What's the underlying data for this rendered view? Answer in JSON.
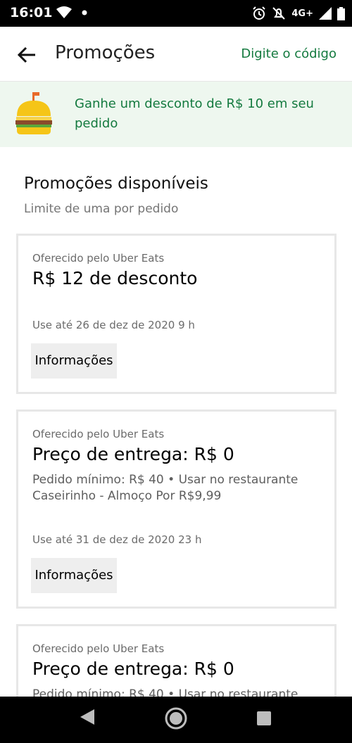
{
  "status_bar": {
    "time": "16:01",
    "network": "4G+",
    "icons": [
      "wifi-icon",
      "dot-icon",
      "alarm-icon",
      "mute-icon",
      "signal-icon",
      "battery-icon"
    ]
  },
  "app_bar": {
    "title": "Promoções",
    "code_link": "Digite o código",
    "back_icon": "arrow-left-icon"
  },
  "banner": {
    "icon": "burger-icon",
    "text": "Ganhe um desconto de R$ 10 em seu pedido"
  },
  "section": {
    "title": "Promoções disponíveis",
    "subtitle": "Limite de uma por pedido"
  },
  "promotions": [
    {
      "offered_by": "Oferecido pelo Uber Eats",
      "headline": "R$ 12 de desconto",
      "details": "",
      "valid_until": "Use até 26 de dez de 2020 9 h",
      "info_label": "Informações"
    },
    {
      "offered_by": "Oferecido pelo Uber Eats",
      "headline": "Preço de entrega: R$ 0",
      "details": "Pedido mínimo: R$ 40 • Usar no restaurante Caseirinho - Almoço Por R$9,99",
      "valid_until": "Use até 31 de dez de 2020 23 h",
      "info_label": "Informações"
    },
    {
      "offered_by": "Oferecido pelo Uber Eats",
      "headline": "Preço de entrega: R$ 0",
      "details": "Pedido mínimo: R$ 40 • Usar no restaurante",
      "valid_until": "",
      "info_label": ""
    }
  ],
  "nav_bar": {
    "icons": [
      "back-triangle-icon",
      "home-circle-icon",
      "recents-square-icon"
    ]
  },
  "colors": {
    "accent_green": "#147a3f",
    "banner_bg": "#eef7ef",
    "card_border": "#e7e7e7",
    "button_bg": "#eeeeee"
  }
}
